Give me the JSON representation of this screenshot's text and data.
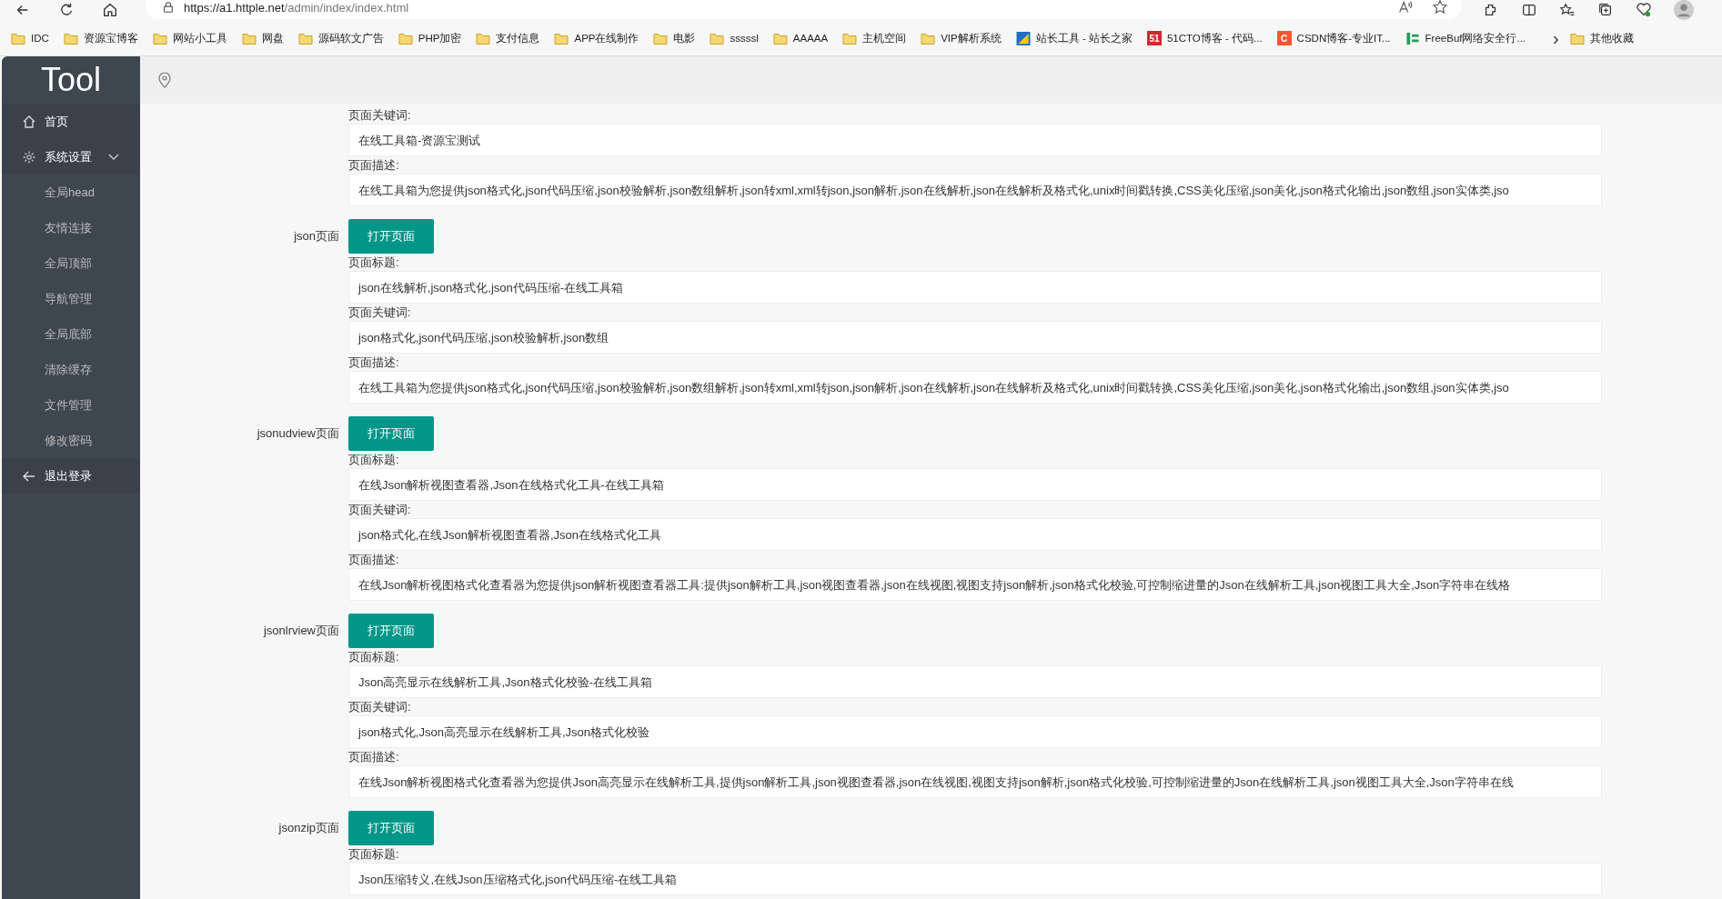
{
  "browser": {
    "url_host": "https://a1.httple.net",
    "url_path": "/admin/index/index.html",
    "bookmarks": [
      {
        "label": "IDC",
        "kind": "folder"
      },
      {
        "label": "资源宝博客",
        "kind": "folder"
      },
      {
        "label": "网站小工具",
        "kind": "folder"
      },
      {
        "label": "网盘",
        "kind": "folder"
      },
      {
        "label": "源码软文广告",
        "kind": "folder"
      },
      {
        "label": "PHP加密",
        "kind": "folder"
      },
      {
        "label": "支付信息",
        "kind": "folder"
      },
      {
        "label": "APP在线制作",
        "kind": "folder"
      },
      {
        "label": "电影",
        "kind": "folder"
      },
      {
        "label": "sssssl",
        "kind": "folder"
      },
      {
        "label": "AAAAA",
        "kind": "folder"
      },
      {
        "label": "主机空间",
        "kind": "folder"
      },
      {
        "label": "VIP解析系统",
        "kind": "folder"
      },
      {
        "label": "站长工具 - 站长之家",
        "kind": "tiles"
      },
      {
        "label": "51CTO博客 - 代码...",
        "kind": "badge",
        "badge": "51",
        "color": "#d0282e"
      },
      {
        "label": "CSDN博客-专业IT...",
        "kind": "badge",
        "badge": "C",
        "color": "#fc5531"
      },
      {
        "label": "FreeBuf网络安全行...",
        "kind": "bars"
      }
    ],
    "more": "›",
    "other": {
      "label": "其他收藏",
      "kind": "folder"
    }
  },
  "sidebar": {
    "logo": "Tool",
    "items": [
      {
        "label": "首页",
        "kind": "home"
      },
      {
        "label": "系统设置",
        "kind": "settings",
        "expanded": true,
        "children": [
          {
            "label": "全局head"
          },
          {
            "label": "友情连接"
          },
          {
            "label": "全局顶部"
          },
          {
            "label": "导航管理"
          },
          {
            "label": "全局底部"
          },
          {
            "label": "清除缓存"
          },
          {
            "label": "文件管理"
          },
          {
            "label": "修改密码"
          }
        ]
      },
      {
        "label": "退出登录",
        "kind": "logout"
      }
    ]
  },
  "sections": [
    {
      "fields": [
        {
          "label": "页面关键词:",
          "value": "在线工具箱-资源宝测试"
        },
        {
          "label": "页面描述:",
          "value": "在线工具箱为您提供json格式化,json代码压缩,json校验解析,json数组解析,json转xml,xml转json,json解析,json在线解析,json在线解析及格式化,unix时间戳转换,CSS美化压缩,json美化,json格式化输出,json数组,json实体类,jso"
        }
      ]
    },
    {
      "name": "json页面",
      "button": "打开页面",
      "fields": [
        {
          "label": "页面标题:",
          "value": "json在线解析,json格式化,json代码压缩-在线工具箱"
        },
        {
          "label": "页面关键词:",
          "value": "json格式化,json代码压缩,json校验解析,json数组"
        },
        {
          "label": "页面描述:",
          "value": "在线工具箱为您提供json格式化,json代码压缩,json校验解析,json数组解析,json转xml,xml转json,json解析,json在线解析,json在线解析及格式化,unix时间戳转换,CSS美化压缩,json美化,json格式化输出,json数组,json实体类,jso"
        }
      ]
    },
    {
      "name": "jsonudview页面",
      "button": "打开页面",
      "fields": [
        {
          "label": "页面标题:",
          "value": "在线Json解析视图查看器,Json在线格式化工具-在线工具箱"
        },
        {
          "label": "页面关键词:",
          "value": "json格式化,在线Json解析视图查看器,Json在线格式化工具"
        },
        {
          "label": "页面描述:",
          "value": "在线Json解析视图格式化查看器为您提供json解析视图查看器工具:提供json解析工具,json视图查看器,json在线视图,视图支持json解析,json格式化校验,可控制缩进量的Json在线解析工具,json视图工具大全,Json字符串在线格"
        }
      ]
    },
    {
      "name": "jsonlrview页面",
      "button": "打开页面",
      "fields": [
        {
          "label": "页面标题:",
          "value": "Json高亮显示在线解析工具,Json格式化校验-在线工具箱"
        },
        {
          "label": "页面关键词:",
          "value": "json格式化,Json高亮显示在线解析工具,Json格式化校验"
        },
        {
          "label": "页面描述:",
          "value": "在线Json解析视图格式化查看器为您提供Json高亮显示在线解析工具,提供json解析工具,json视图查看器,json在线视图,视图支持json解析,json格式化校验,可控制缩进量的Json在线解析工具,json视图工具大全,Json字符串在线"
        }
      ]
    },
    {
      "name": "jsonzip页面",
      "button": "打开页面",
      "fields": [
        {
          "label": "页面标题:",
          "value": "Json压缩转义,在线Json压缩格式化,json代码压缩-在线工具箱"
        }
      ]
    }
  ]
}
